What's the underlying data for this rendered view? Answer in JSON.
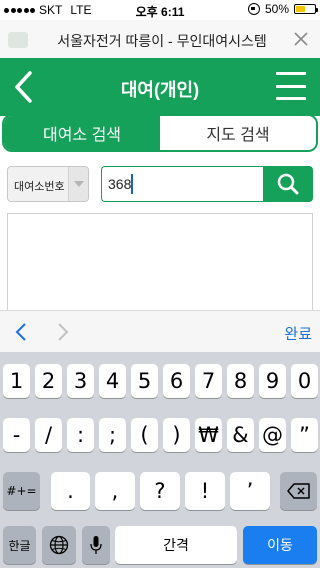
{
  "status_bar": {
    "carrier": "SKT",
    "network": "LTE",
    "time": "오후 6:11",
    "battery": "50%",
    "battery_level": 0.5
  },
  "browser": {
    "title": "서울자전거 따릉이 - 무인대여시스템"
  },
  "header": {
    "title": "대여(개인)"
  },
  "tabs": [
    {
      "label": "대여소 검색",
      "active": true
    },
    {
      "label": "지도 검색",
      "active": false
    }
  ],
  "search": {
    "type_value": "대여소번호",
    "query": "368"
  },
  "accessory": {
    "done_label": "완료"
  },
  "keyboard": {
    "row1": [
      "1",
      "2",
      "3",
      "4",
      "5",
      "6",
      "7",
      "8",
      "9",
      "0"
    ],
    "row2": [
      "-",
      "/",
      ":",
      ";",
      "(",
      ")",
      "₩",
      "&",
      "@",
      "”"
    ],
    "shift_label": "#+=",
    "row3": [
      ".",
      ",",
      "?",
      "!",
      "’"
    ],
    "lang_label": "한글",
    "space_label": "간격",
    "return_label": "이동"
  },
  "colors": {
    "brand_green": "#16a15a",
    "ios_blue": "#1a7df0"
  },
  "icons": [
    "back-chevron-icon",
    "menu-icon",
    "search-icon",
    "close-icon",
    "globe-icon",
    "microphone-icon",
    "backspace-icon"
  ]
}
